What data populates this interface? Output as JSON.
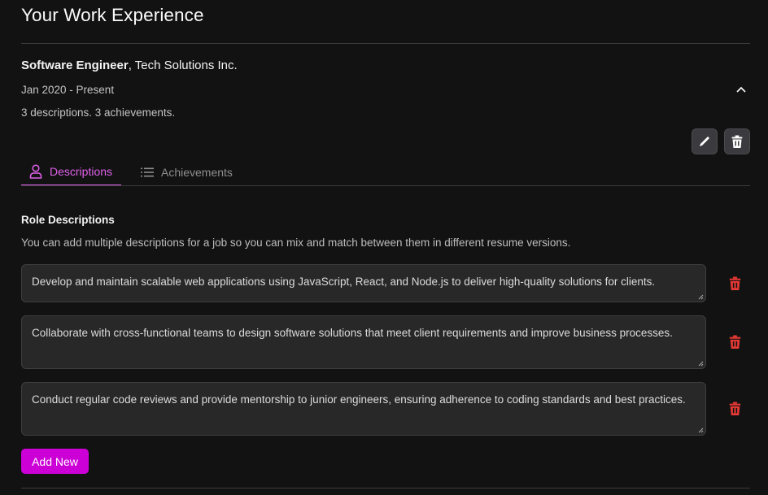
{
  "page": {
    "title": "Your Work Experience"
  },
  "job": {
    "role": "Software Engineer",
    "separator": ",",
    "company": " Tech Solutions Inc.",
    "dates": "Jan 2020 - Present",
    "summary": "3 descriptions. 3 achievements.",
    "collapse_icon": "chevron-up-icon",
    "edit_icon": "pencil-icon",
    "delete_icon": "trash-icon"
  },
  "tabs": [
    {
      "label": "Descriptions",
      "icon": "user-icon",
      "active": true
    },
    {
      "label": "Achievements",
      "icon": "list-icon",
      "active": false
    }
  ],
  "section": {
    "title": "Role Descriptions",
    "help": "You can add multiple descriptions for a job so you can mix and match between them in different resume versions."
  },
  "descriptions": [
    {
      "text": "Develop and maintain scalable web applications using JavaScript, React, and Node.js to deliver high-quality solutions for clients."
    },
    {
      "text": "Collaborate with cross-functional teams to design software solutions that meet client requirements and improve business processes."
    },
    {
      "text": "Conduct regular code reviews and provide mentorship to junior engineers, ensuring adherence to coding standards and best practices."
    }
  ],
  "actions": {
    "add_new": "Add New"
  },
  "colors": {
    "accent": "#cc00d6",
    "tab_active": "#e060ea",
    "danger": "#e53935",
    "background": "#121212"
  }
}
